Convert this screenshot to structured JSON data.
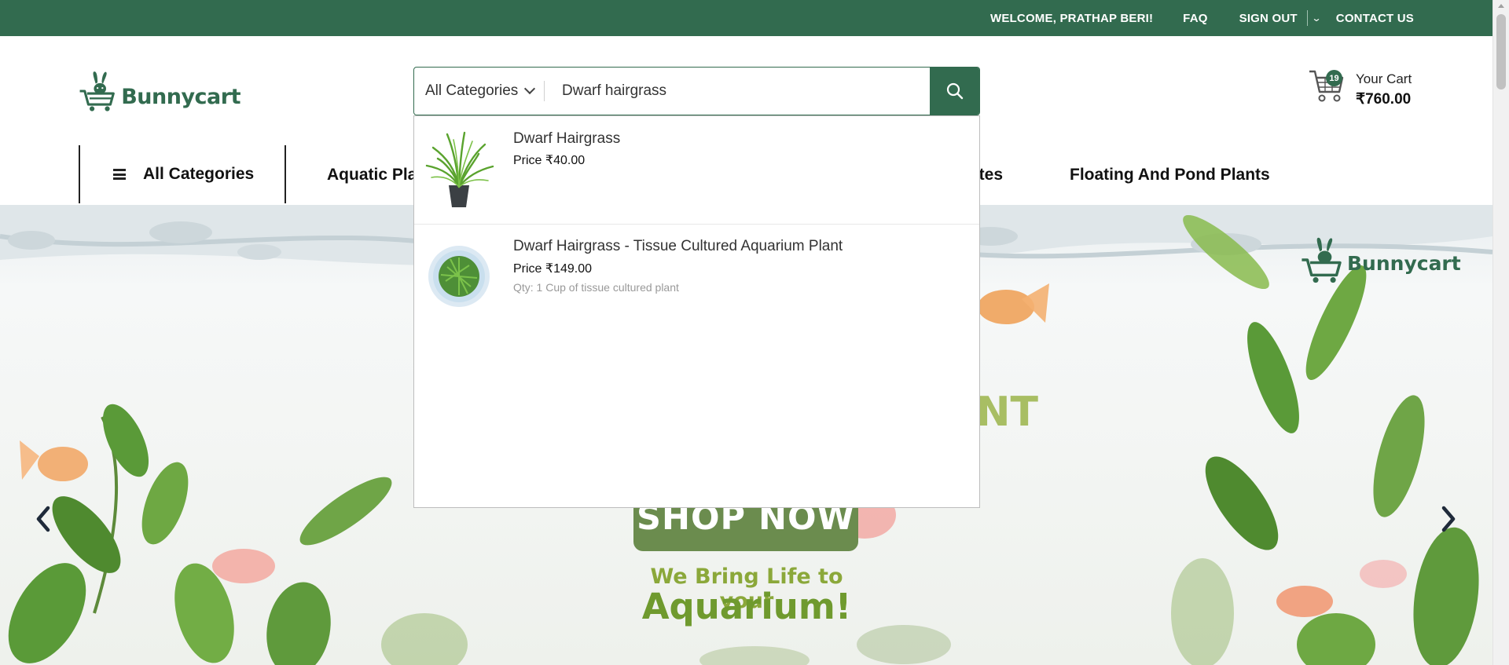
{
  "topbar": {
    "welcome": "WELCOME, PRATHAP BERI!",
    "faq": "FAQ",
    "signout": "SIGN OUT",
    "contact": "CONTACT US"
  },
  "brand": {
    "name": "Bunnycart",
    "color": "#326b4f"
  },
  "search": {
    "category": "All Categories",
    "value": "Dwarf hairgrass",
    "icon": "search-icon"
  },
  "cart": {
    "count": "19",
    "label": "Your Cart",
    "total": "₹760.00"
  },
  "nav": {
    "all_categories": "All Categories",
    "items": [
      "Aquatic Pla",
      "ytes",
      "Floating And Pond Plants"
    ]
  },
  "suggestions": [
    {
      "name": "Dwarf Hairgrass",
      "price": "Price ₹40.00",
      "qty": ""
    },
    {
      "name": "Dwarf Hairgrass - Tissue Cultured Aquarium Plant",
      "price": "Price ₹149.00",
      "qty": "Qty: 1 Cup of tissue cultured plant"
    }
  ],
  "hero": {
    "brand": "Bunnycart",
    "faded_text": "NT",
    "button": "SHOP NOW",
    "tagline_line1": "We Bring Life to your",
    "tagline_line2": "Aquarium!"
  }
}
